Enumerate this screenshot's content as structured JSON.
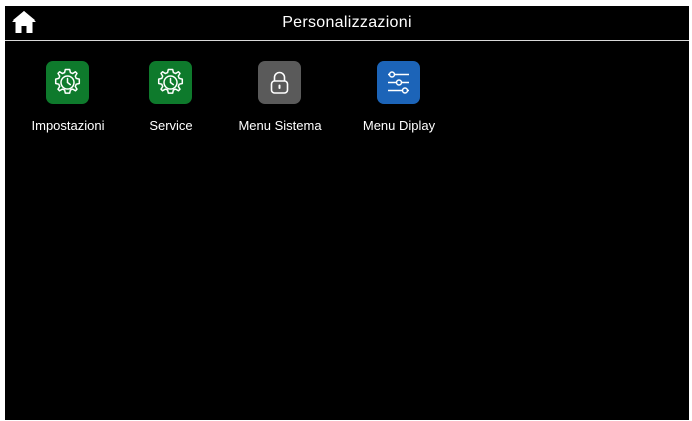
{
  "header": {
    "title": "Personalizzazioni",
    "home_icon": "home-icon"
  },
  "tiles": [
    {
      "label": "Impostazioni",
      "icon": "gear-clock-icon",
      "color": "#0e7a2c"
    },
    {
      "label": "Service",
      "icon": "gear-clock-icon",
      "color": "#0e7a2c"
    },
    {
      "label": "Menu Sistema",
      "icon": "padlock-icon",
      "color": "#5a5a5a"
    },
    {
      "label": "Menu Diplay",
      "icon": "sliders-icon",
      "color": "#1c64b8"
    }
  ],
  "colors": {
    "background": "#000000",
    "text": "#ffffff",
    "divider": "#d9d9d9"
  }
}
